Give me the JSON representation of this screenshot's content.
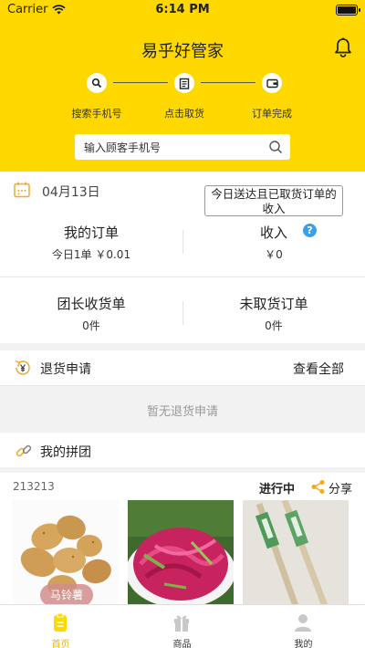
{
  "status_bar": {
    "carrier": "Carrier",
    "time": "6:14 PM"
  },
  "header": {
    "title": "易乎好管家"
  },
  "steps": [
    {
      "label": "搜索手机号",
      "icon": "search-icon"
    },
    {
      "label": "点击取货",
      "icon": "clipboard-icon"
    },
    {
      "label": "订单完成",
      "icon": "wallet-icon"
    }
  ],
  "search": {
    "placeholder": "输入顾客手机号"
  },
  "summary": {
    "date": "04月13日",
    "notice_button": "今日送达且已取货订单的收入",
    "orders_title": "我的订单",
    "orders_sub": "今日1单 ￥0.01",
    "income_title": "收入",
    "income_value": "￥0",
    "help": "?"
  },
  "pickup": {
    "leader_title": "团长收货单",
    "leader_value": "0件",
    "pending_title": "未取货订单",
    "pending_value": "0件"
  },
  "returns": {
    "label": "退货申请",
    "view_all": "查看全部",
    "empty": "暂无退货申请"
  },
  "group": {
    "label": "我的拼团",
    "id": "213213",
    "status": "进行中",
    "share": "分享",
    "products": [
      {
        "label": "马铃薯"
      }
    ]
  },
  "tabbar": {
    "tabs": [
      {
        "label": "首页",
        "active": true
      },
      {
        "label": "商品",
        "active": false
      },
      {
        "label": "我的",
        "active": false
      }
    ]
  },
  "colors": {
    "brand_yellow": "#ffd800",
    "accent_blue": "#3aa0e8",
    "share_orange": "#f5a623"
  }
}
